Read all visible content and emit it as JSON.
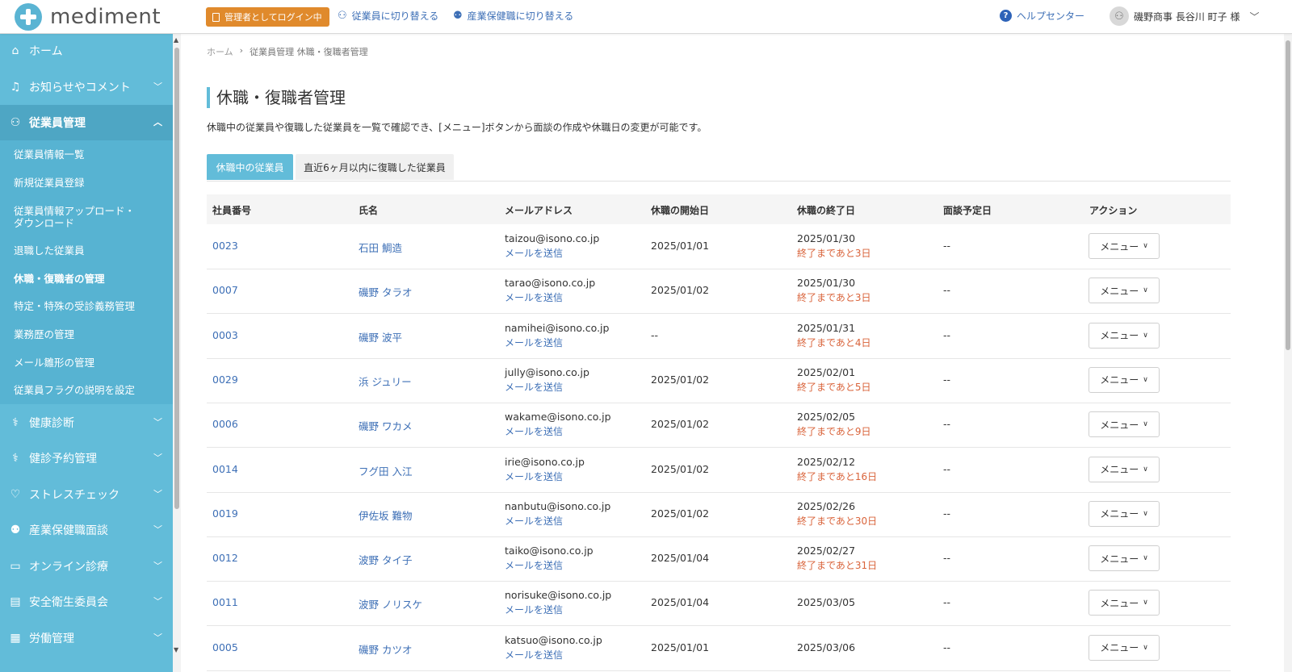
{
  "header": {
    "logo_text": "mediment",
    "admin_badge": "管理者としてログイン中",
    "switch_employee": "従業員に切り替える",
    "switch_health": "産業保健職に切り替える",
    "help": "ヘルプセンター",
    "user_name": "磯野商事 長谷川 町子 様"
  },
  "sidebar": {
    "items": [
      {
        "label": "ホーム",
        "icon": "home-icon"
      },
      {
        "label": "お知らせやコメント",
        "icon": "bell-icon"
      },
      {
        "label": "従業員管理",
        "icon": "users-icon"
      },
      {
        "label": "健康診断",
        "icon": "stethoscope-icon"
      },
      {
        "label": "健診予約管理",
        "icon": "stethoscope-icon"
      },
      {
        "label": "ストレスチェック",
        "icon": "heart-icon"
      },
      {
        "label": "産業保健職面談",
        "icon": "people-icon"
      },
      {
        "label": "オンライン診療",
        "icon": "monitor-icon"
      },
      {
        "label": "安全衛生委員会",
        "icon": "document-icon"
      },
      {
        "label": "労働管理",
        "icon": "calendar-icon"
      }
    ],
    "sub_items": [
      "従業員情報一覧",
      "新規従業員登録",
      "従業員情報アップロード・",
      "ダウンロード",
      "退職した従業員",
      "休職・復職者の管理",
      "特定・特殊の受診義務管理",
      "業務歴の管理",
      "メール雛形の管理",
      "従業員フラグの説明を設定"
    ]
  },
  "breadcrumb": {
    "home": "ホーム",
    "sep": "›",
    "current": "従業員管理 休職・復職者管理"
  },
  "page": {
    "title": "休職・復職者管理",
    "description": "休職中の従業員や復職した従業員を一覧で確認でき、[メニュー]ボタンから面談の作成や休職日の変更が可能です。"
  },
  "tabs": {
    "active": "休職中の従業員",
    "inactive": "直近6ヶ月以内に復職した従業員"
  },
  "table": {
    "headers": [
      "社員番号",
      "氏名",
      "メールアドレス",
      "休職の開始日",
      "休職の終了日",
      "面談予定日",
      "アクション"
    ],
    "send_mail": "メールを送信",
    "menu_label": "メニュー",
    "rows": [
      {
        "id": "0023",
        "name": "石田 鯛造",
        "email": "taizou@isono.co.jp",
        "start": "2025/01/01",
        "end": "2025/01/30",
        "remain": "終了まであと3日",
        "interview": "--"
      },
      {
        "id": "0007",
        "name": "磯野 タラオ",
        "email": "tarao@isono.co.jp",
        "start": "2025/01/02",
        "end": "2025/01/30",
        "remain": "終了まであと3日",
        "interview": "--"
      },
      {
        "id": "0003",
        "name": "磯野 波平",
        "email": "namihei@isono.co.jp",
        "start": "--",
        "end": "2025/01/31",
        "remain": "終了まであと4日",
        "interview": "--"
      },
      {
        "id": "0029",
        "name": "浜 ジュリー",
        "email": "jully@isono.co.jp",
        "start": "2025/01/02",
        "end": "2025/02/01",
        "remain": "終了まであと5日",
        "interview": "--"
      },
      {
        "id": "0006",
        "name": "磯野 ワカメ",
        "email": "wakame@isono.co.jp",
        "start": "2025/01/02",
        "end": "2025/02/05",
        "remain": "終了まであと9日",
        "interview": "--"
      },
      {
        "id": "0014",
        "name": "フグ田 入江",
        "email": "irie@isono.co.jp",
        "start": "2025/01/02",
        "end": "2025/02/12",
        "remain": "終了まであと16日",
        "interview": "--"
      },
      {
        "id": "0019",
        "name": "伊佐坂 難物",
        "email": "nanbutu@isono.co.jp",
        "start": "2025/01/02",
        "end": "2025/02/26",
        "remain": "終了まであと30日",
        "interview": "--"
      },
      {
        "id": "0012",
        "name": "波野 タイ子",
        "email": "taiko@isono.co.jp",
        "start": "2025/01/04",
        "end": "2025/02/27",
        "remain": "終了まであと31日",
        "interview": "--"
      },
      {
        "id": "0011",
        "name": "波野 ノリスケ",
        "email": "norisuke@isono.co.jp",
        "start": "2025/01/04",
        "end": "2025/03/05",
        "remain": "",
        "interview": "--"
      },
      {
        "id": "0005",
        "name": "磯野 カツオ",
        "email": "katsuo@isono.co.jp",
        "start": "2025/01/01",
        "end": "2025/03/06",
        "remain": "",
        "interview": "--"
      }
    ]
  },
  "colors": {
    "sidebar": "#62bcd9",
    "accent": "#3d6fb6",
    "warning": "#d9633a",
    "badge": "#e08a2c"
  }
}
